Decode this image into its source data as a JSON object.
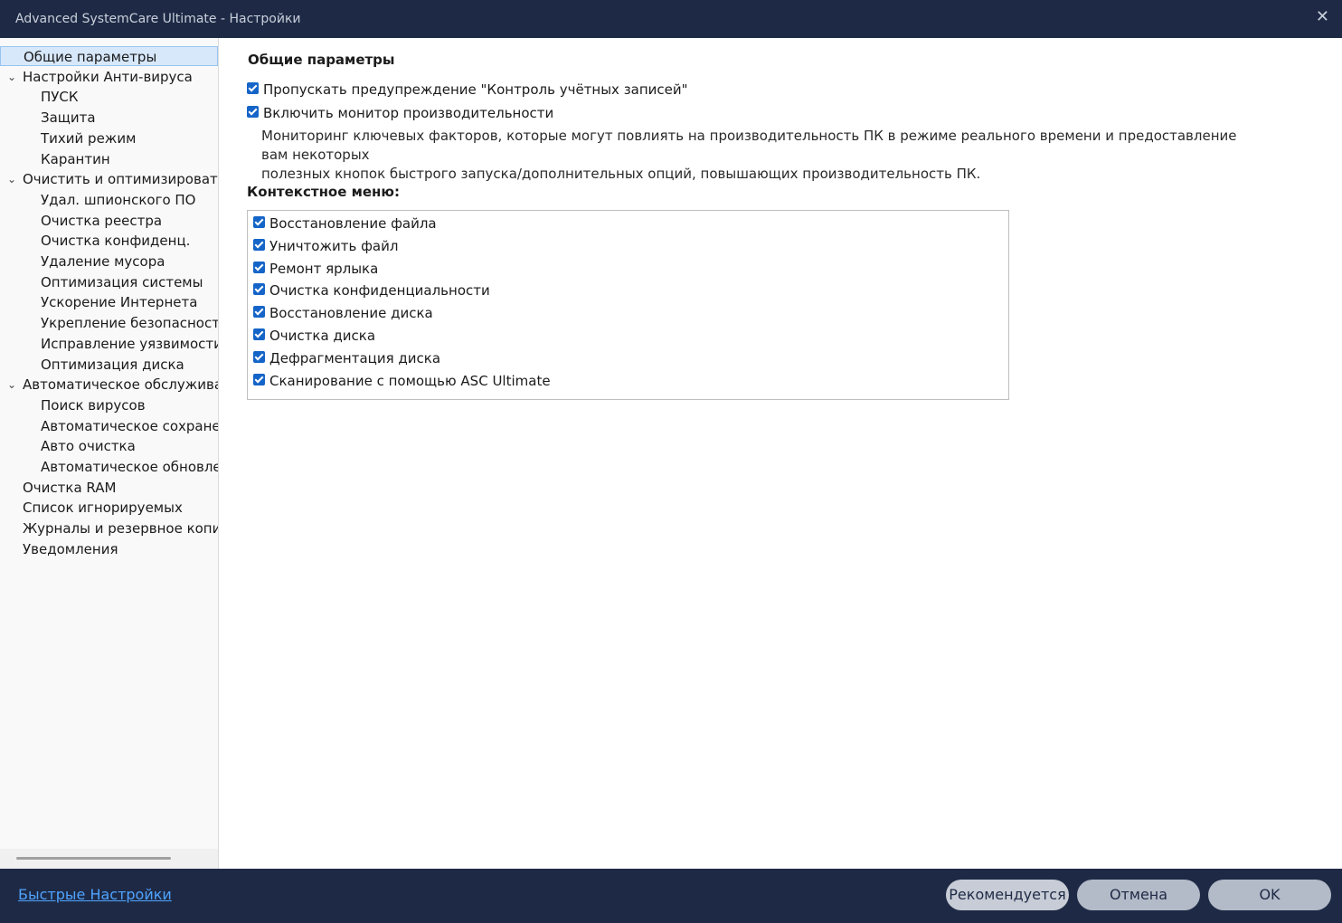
{
  "window": {
    "title": "Advanced SystemCare Ultimate - Настройки"
  },
  "sidebar": {
    "items": [
      {
        "label": "Общие параметры",
        "level": 0,
        "selected": true
      },
      {
        "label": "Настройки Анти-вируса",
        "level": 0,
        "expanded": true
      },
      {
        "label": "ПУСК",
        "level": 1
      },
      {
        "label": "Защита",
        "level": 1
      },
      {
        "label": "Тихий режим",
        "level": 1
      },
      {
        "label": "Карантин",
        "level": 1
      },
      {
        "label": "Очистить и оптимизировать",
        "level": 0,
        "expanded": true
      },
      {
        "label": "Удал. шпионского ПО",
        "level": 1
      },
      {
        "label": "Очистка реестра",
        "level": 1
      },
      {
        "label": "Очистка конфиденц.",
        "level": 1
      },
      {
        "label": "Удаление мусора",
        "level": 1
      },
      {
        "label": "Оптимизация системы",
        "level": 1
      },
      {
        "label": "Ускорение Интернета",
        "level": 1
      },
      {
        "label": "Укрепление безопасности",
        "level": 1
      },
      {
        "label": "Исправление уязвимости",
        "level": 1
      },
      {
        "label": "Оптимизация диска",
        "level": 1
      },
      {
        "label": "Автоматическое обслуживание",
        "level": 0,
        "expanded": true
      },
      {
        "label": "Поиск вирусов",
        "level": 1
      },
      {
        "label": "Автоматическое сохранение",
        "level": 1
      },
      {
        "label": "Авто очистка",
        "level": 1
      },
      {
        "label": "Автоматическое обновление",
        "level": 1
      },
      {
        "label": "Очистка RAM",
        "level": 0
      },
      {
        "label": "Список игнорируемых",
        "level": 0
      },
      {
        "label": "Журналы и резервное копирование",
        "level": 0
      },
      {
        "label": "Уведомления",
        "level": 0
      }
    ]
  },
  "main": {
    "heading": "Общие параметры",
    "options": [
      {
        "label": "Пропускать предупреждение \"Контроль учётных записей\"",
        "checked": true
      },
      {
        "label": "Включить монитор производительности",
        "checked": true
      }
    ],
    "description_line1": "Мониторинг ключевых факторов, которые могут повлиять на производительность ПК в режиме реального времени и предоставление вам некоторых",
    "description_line2": "полезных кнопок быстрого запуска/дополнительных опций, повышающих производительность ПК.",
    "context_heading": "Контекстное меню:",
    "context_items": [
      {
        "label": "Восстановление файла",
        "checked": true
      },
      {
        "label": "Уничтожить файл",
        "checked": true
      },
      {
        "label": "Ремонт ярлыка",
        "checked": true
      },
      {
        "label": "Очистка конфиденциальности",
        "checked": true
      },
      {
        "label": "Восстановление диска",
        "checked": true
      },
      {
        "label": "Очистка диска",
        "checked": true
      },
      {
        "label": "Дефрагментация диска",
        "checked": true
      },
      {
        "label": "Сканирование с помощью ASC Ultimate",
        "checked": true
      }
    ]
  },
  "footer": {
    "quick_settings_label": "Быстрые Настройки",
    "recommended_label": "Рекомендуется",
    "cancel_label": "Отмена",
    "ok_label": "OK"
  },
  "icons": {
    "close": "close-icon",
    "chevron": "chevron-down-icon",
    "checkbox": "checkbox-checked-icon"
  },
  "colors": {
    "titlebar": "#1e2a45",
    "checkbox": "#1565c8",
    "link": "#4fa3ff",
    "selection": "#d7e8fb"
  }
}
